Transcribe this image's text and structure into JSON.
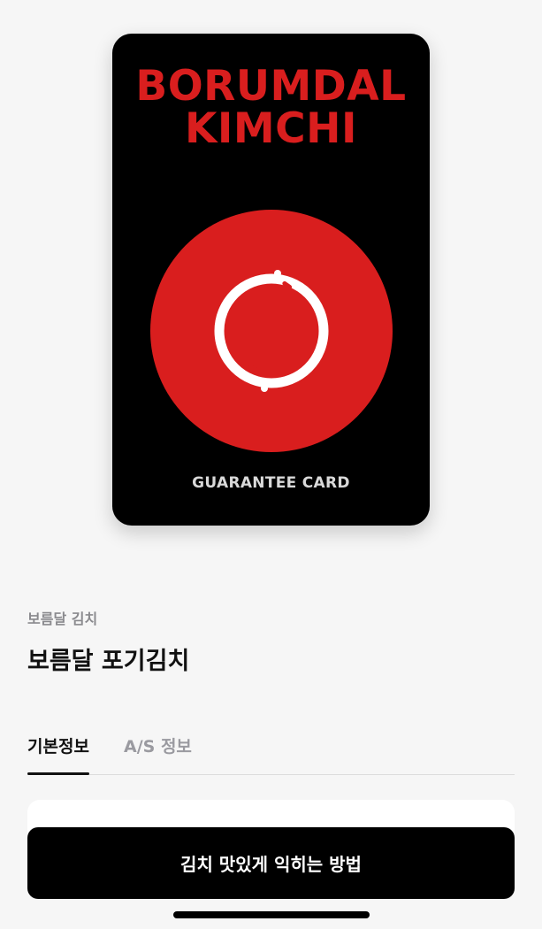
{
  "card": {
    "brand_line1": "BORUMDAL",
    "brand_line2": "KIMCHI",
    "footer": "GUARANTEE CARD",
    "emblem_icon": "red-circle-ring-icon",
    "colors": {
      "background": "#000000",
      "brand_red": "#d91e1e",
      "footer_text": "#d9d9d9"
    }
  },
  "product": {
    "brand": "보름달 김치",
    "title": "보름달 포기김치"
  },
  "tabs": [
    {
      "label": "기본정보",
      "active": true
    },
    {
      "label": "A/S 정보",
      "active": false
    }
  ],
  "cta": {
    "label": "김치 맛있게 익히는 방법"
  }
}
